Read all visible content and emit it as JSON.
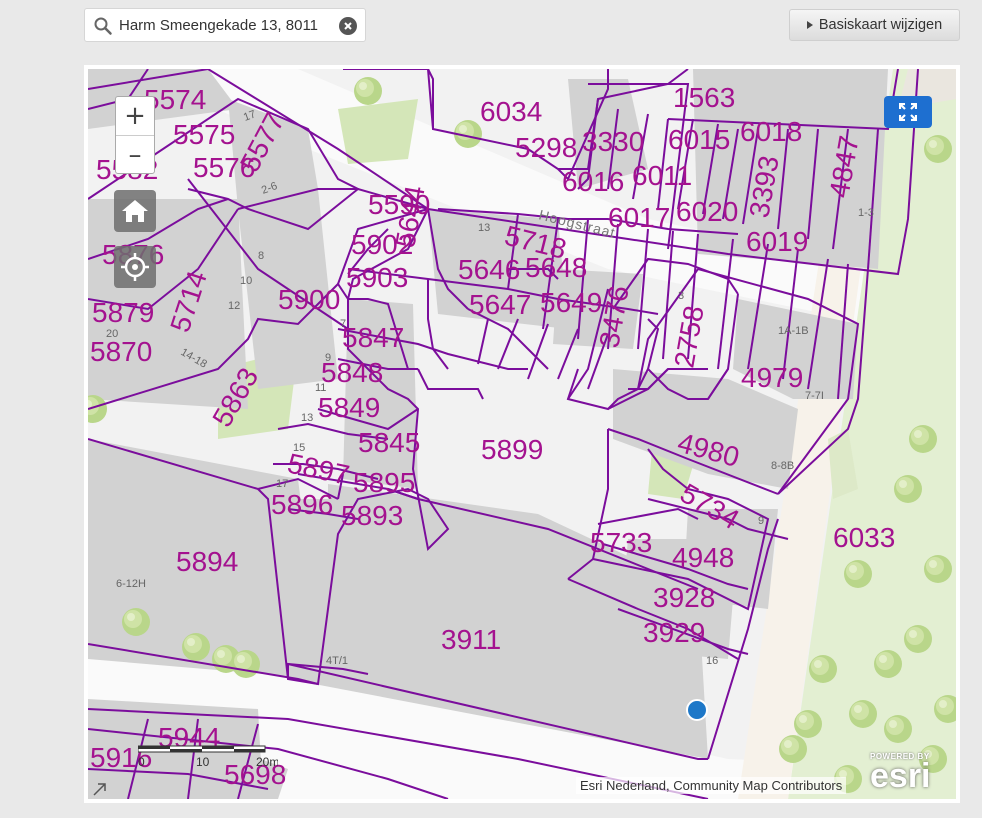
{
  "search": {
    "value": "Harm Smeengekade 13, 8011",
    "search_icon": "search-icon",
    "clear_icon": "close-icon"
  },
  "basemap_button": {
    "label": "Basiskaart wijzigen",
    "icon": "caret-right-icon"
  },
  "map": {
    "zoom_in_label": "+",
    "zoom_out_label": "–",
    "controls_icons": [
      "home-icon",
      "locate-icon",
      "fullscreen-icon"
    ],
    "street_label": "Hoogstraat",
    "colors": {
      "parcel_line": "#7b0d9c",
      "parcel_label": "#a4128f",
      "building": "#d2d2d2",
      "ground": "#f2f2f2",
      "green": "#d4e6b8",
      "location_marker": "#1e78c8",
      "accent_button": "#1e6fd0"
    },
    "parcel_labels": [
      "5574",
      "5575",
      "5576",
      "5577",
      "5582",
      "5590",
      "5644",
      "5718",
      "5646",
      "5648",
      "5647",
      "5649",
      "5902",
      "5903",
      "5900",
      "5847",
      "5848",
      "5849",
      "5845",
      "5897",
      "5895",
      "5896",
      "5893",
      "5894",
      "5899",
      "5863",
      "5714",
      "5879",
      "5870",
      "6034",
      "5298",
      "3330",
      "6015",
      "6018",
      "1563",
      "6016",
      "6011",
      "6017",
      "6020",
      "3393",
      "4847",
      "6019",
      "3476",
      "2758",
      "4979",
      "4980",
      "5734",
      "5733",
      "4948",
      "3928",
      "3929",
      "3911",
      "6033",
      "5944",
      "5698",
      "5916",
      "5876"
    ],
    "house_numbers": [
      "17",
      "2-6",
      "8",
      "10",
      "12",
      "14-18",
      "20",
      "7",
      "9",
      "11",
      "13",
      "15",
      "17",
      "6-12H",
      "4T/1",
      "13",
      "3",
      "1A-1B",
      "7-7I",
      "8-8B",
      "9",
      "1-3",
      "16"
    ],
    "scale": {
      "ticks": [
        "0",
        "10",
        "20m"
      ]
    },
    "attribution": "Esri Nederland, Community Map Contributors",
    "logo": {
      "powered": "POWERED BY",
      "word": "esri"
    }
  }
}
